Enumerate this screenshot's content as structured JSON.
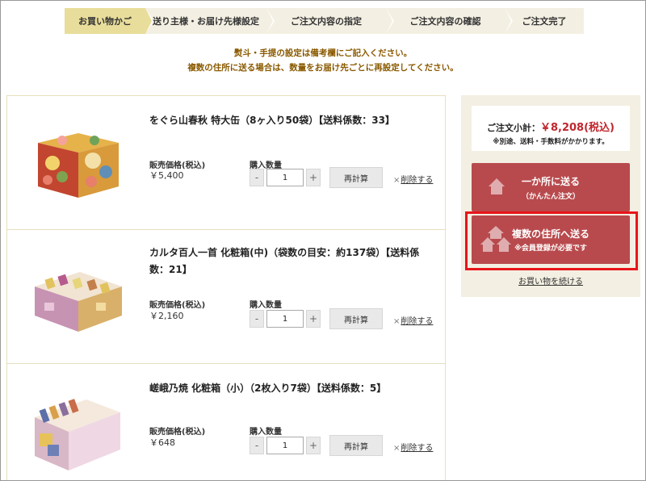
{
  "steps": [
    {
      "label": "お買い物かご",
      "active": true
    },
    {
      "label": "送り主様・お届け先様設定",
      "active": false
    },
    {
      "label": "ご注文内容の指定",
      "active": false
    },
    {
      "label": "ご注文内容の確認",
      "active": false
    },
    {
      "label": "ご注文完了",
      "active": false
    }
  ],
  "notice": {
    "line1": "熨斗・手提の設定は備考欄にご記入ください。",
    "line2": "複数の住所に送る場合は、数量をお届け先ごとに再設定してください。"
  },
  "items": [
    {
      "title": "をぐら山春秋 特大缶（8ヶ入り50袋）【送料係数：33】",
      "price_label": "販売価格(税込)",
      "price": "￥5,400",
      "qty_label": "購入数量",
      "quantity": "1",
      "minus": "-",
      "plus": "+",
      "recalc": "再計算",
      "delete_x": "×",
      "delete": "削除する"
    },
    {
      "title": "カルタ百人一首 化粧箱(中)（袋数の目安：約137袋）【送料係数：21】",
      "price_label": "販売価格(税込)",
      "price": "￥2,160",
      "qty_label": "購入数量",
      "quantity": "1",
      "minus": "-",
      "plus": "+",
      "recalc": "再計算",
      "delete_x": "×",
      "delete": "削除する"
    },
    {
      "title": "嵯峨乃焼 化粧箱（小）（2枚入り7袋）【送料係数：5】",
      "price_label": "販売価格(税込)",
      "price": "￥648",
      "qty_label": "購入数量",
      "quantity": "1",
      "minus": "-",
      "plus": "+",
      "recalc": "再計算",
      "delete_x": "×",
      "delete": "削除する"
    }
  ],
  "sidebar": {
    "subtotal_label": "ご注文小計：",
    "subtotal_amount": "￥8,208(税込)",
    "subtotal_note": "※別途、送料・手数料がかかります。",
    "single_main": "一か所に送る",
    "single_sub": "（かんたん注文）",
    "multi_main": "複数の住所へ送る",
    "multi_sub": "※会員登録が必要です",
    "continue": "お買い物を続ける",
    "icons": {
      "single": "house-icon",
      "multi": "houses-icon"
    },
    "colors": {
      "button": "#b84a4d",
      "highlight": "#e8151b",
      "price": "#c0262d"
    }
  }
}
